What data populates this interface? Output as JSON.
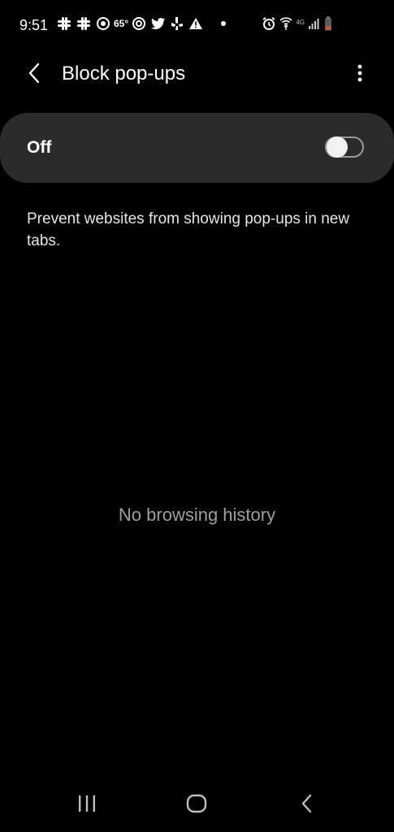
{
  "status_bar": {
    "time": "9:51",
    "temperature": "65°",
    "network_label": "4G",
    "left_icons": [
      "slack-icon",
      "slack-icon",
      "weather-icon",
      "sync-icon",
      "twitter-icon",
      "yelp-icon",
      "warning-icon",
      "dot-icon"
    ],
    "right_icons": [
      "alarm-icon",
      "wifi-calling-icon",
      "signal-icon",
      "battery-icon"
    ]
  },
  "app_bar": {
    "back_icon": "chevron-left-icon",
    "title": "Block pop-ups",
    "more_icon": "more-vert-icon"
  },
  "master_switch": {
    "label": "Off",
    "state": "off"
  },
  "description": "Prevent websites from showing pop-ups in new tabs.",
  "empty_state": "No browsing history",
  "nav_bar": {
    "recents_icon": "recents-icon",
    "home_icon": "home-icon",
    "back_icon": "back-icon"
  },
  "colors": {
    "background": "#000000",
    "card": "#2b2b2b",
    "text_primary": "#ffffff",
    "text_secondary": "#9e9e9e",
    "toggle_border": "#9a9a9a"
  }
}
